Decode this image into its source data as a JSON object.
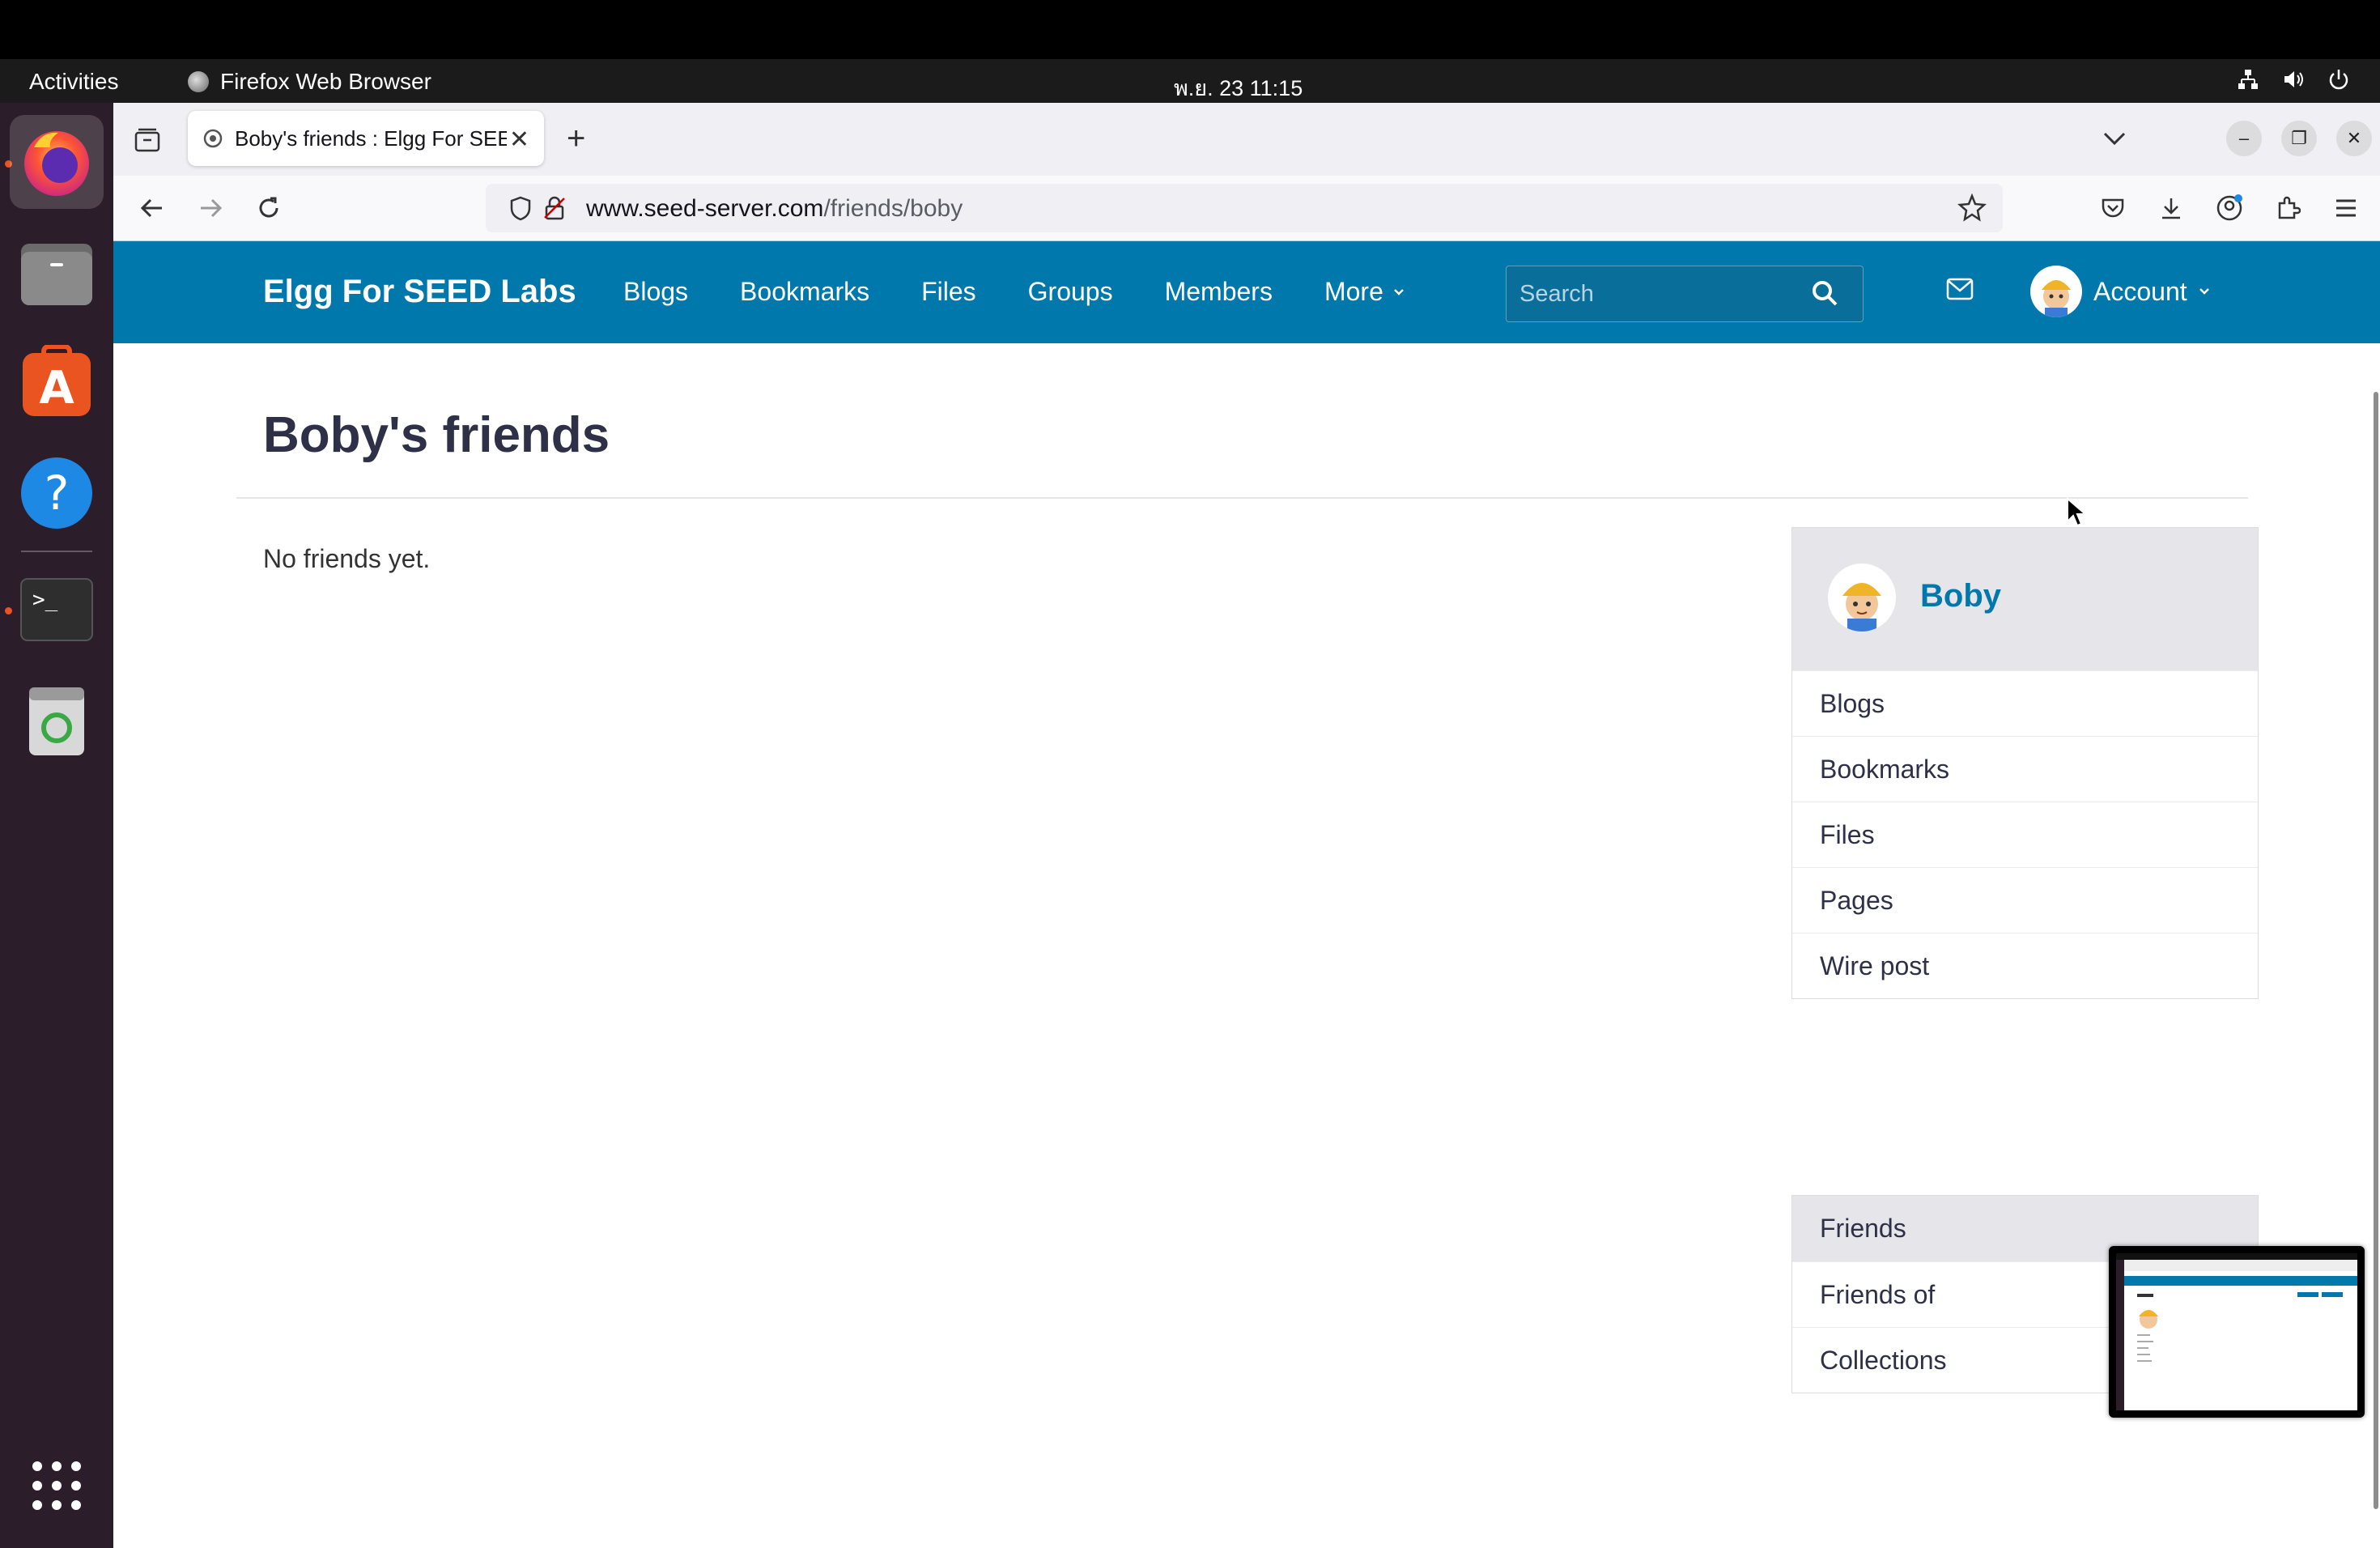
{
  "system": {
    "activities": "Activities",
    "app_name": "Firefox Web Browser",
    "clock": "พ.ย. 23  11:15"
  },
  "browser": {
    "tab_title": "Boby's friends : Elgg For SEED Labs",
    "url_host": "www.seed-server.com",
    "url_path": "/friends/boby"
  },
  "elgg": {
    "site_name": "Elgg For SEED Labs",
    "nav": [
      "Blogs",
      "Bookmarks",
      "Files",
      "Groups",
      "Members",
      "More"
    ],
    "search_placeholder": "Search",
    "account_label": "Account"
  },
  "content": {
    "page_title": "Boby's friends",
    "empty_message": "No friends yet."
  },
  "sidebar": {
    "owner_name": "Boby",
    "owner_menu": [
      "Blogs",
      "Bookmarks",
      "Files",
      "Pages",
      "Wire post"
    ],
    "friends_menu": [
      "Friends",
      "Friends of",
      "Collections"
    ],
    "selected": "Friends"
  },
  "colors": {
    "elgg_blue": "#0078ac",
    "ubuntu_orange": "#e95420"
  }
}
